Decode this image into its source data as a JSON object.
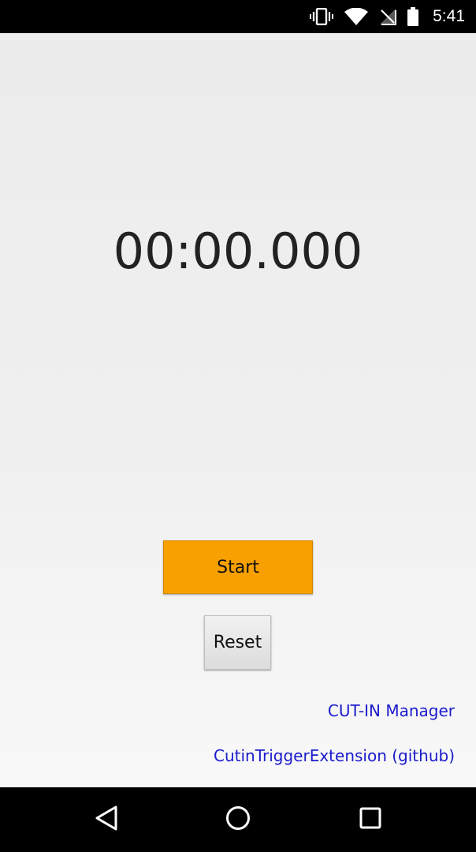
{
  "status_bar": {
    "time": "5:41",
    "icons": [
      "vibrate-icon",
      "wifi-icon",
      "no-signal-icon",
      "battery-icon"
    ]
  },
  "stopwatch": {
    "display": "00:00.000"
  },
  "buttons": {
    "start_label": "Start",
    "reset_label": "Reset"
  },
  "links": {
    "cutin_manager": "CUT-IN Manager",
    "github": "CutinTriggerExtension (github)"
  },
  "nav_bar": {
    "icons": [
      "back-icon",
      "home-icon",
      "recents-icon"
    ]
  },
  "colors": {
    "start_button": "#f8a000",
    "link": "#1a1acc",
    "background": "#efefef"
  }
}
